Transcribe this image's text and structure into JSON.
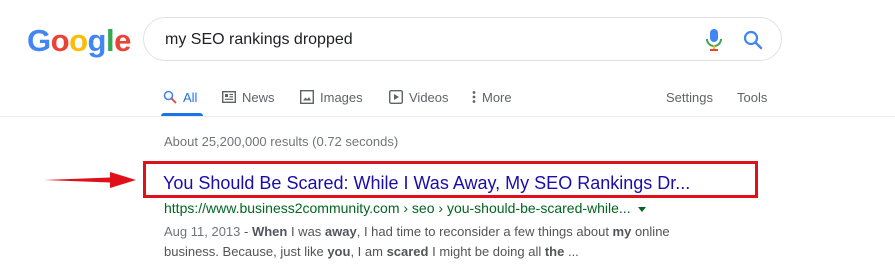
{
  "logo": {
    "letters": [
      "G",
      "o",
      "o",
      "g",
      "l",
      "e"
    ],
    "colors": [
      "#4285f4",
      "#ea4335",
      "#fbbc05",
      "#4285f4",
      "#34a853",
      "#ea4335"
    ]
  },
  "search": {
    "query": "my SEO rankings dropped"
  },
  "tabs": [
    {
      "label": "All",
      "icon": "search-icon",
      "active": true
    },
    {
      "label": "News",
      "icon": "news-icon",
      "active": false
    },
    {
      "label": "Images",
      "icon": "image-icon",
      "active": false
    },
    {
      "label": "Videos",
      "icon": "play-icon",
      "active": false
    },
    {
      "label": "More",
      "icon": "more-vertical-icon",
      "active": false
    }
  ],
  "tools": {
    "settings_label": "Settings",
    "tools_label": "Tools"
  },
  "stats": "About 25,200,000 results (0.72 seconds)",
  "result": {
    "title": "You Should Be Scared: While I Was Away, My SEO Rankings Dr...",
    "url": "https://www.business2community.com › seo › you-should-be-scared-while...",
    "date": "Aug 11, 2013",
    "snippet_parts": [
      {
        "t": " - ",
        "b": false
      },
      {
        "t": "When",
        "b": true
      },
      {
        "t": " I was ",
        "b": false
      },
      {
        "t": "away",
        "b": true
      },
      {
        "t": ", I had time to reconsider a few things about ",
        "b": false
      },
      {
        "t": "my",
        "b": true
      },
      {
        "t": " online business. Because, just like ",
        "b": false
      },
      {
        "t": "you",
        "b": true
      },
      {
        "t": ", I am ",
        "b": false
      },
      {
        "t": "scared",
        "b": true
      },
      {
        "t": " I might be doing all ",
        "b": false
      },
      {
        "t": "the",
        "b": true
      },
      {
        "t": " ...",
        "b": false
      }
    ]
  },
  "accent": {
    "link": "#1a0dab",
    "url": "#006621",
    "highlight": "#e0101a",
    "tab_active": "#1a73e8"
  }
}
